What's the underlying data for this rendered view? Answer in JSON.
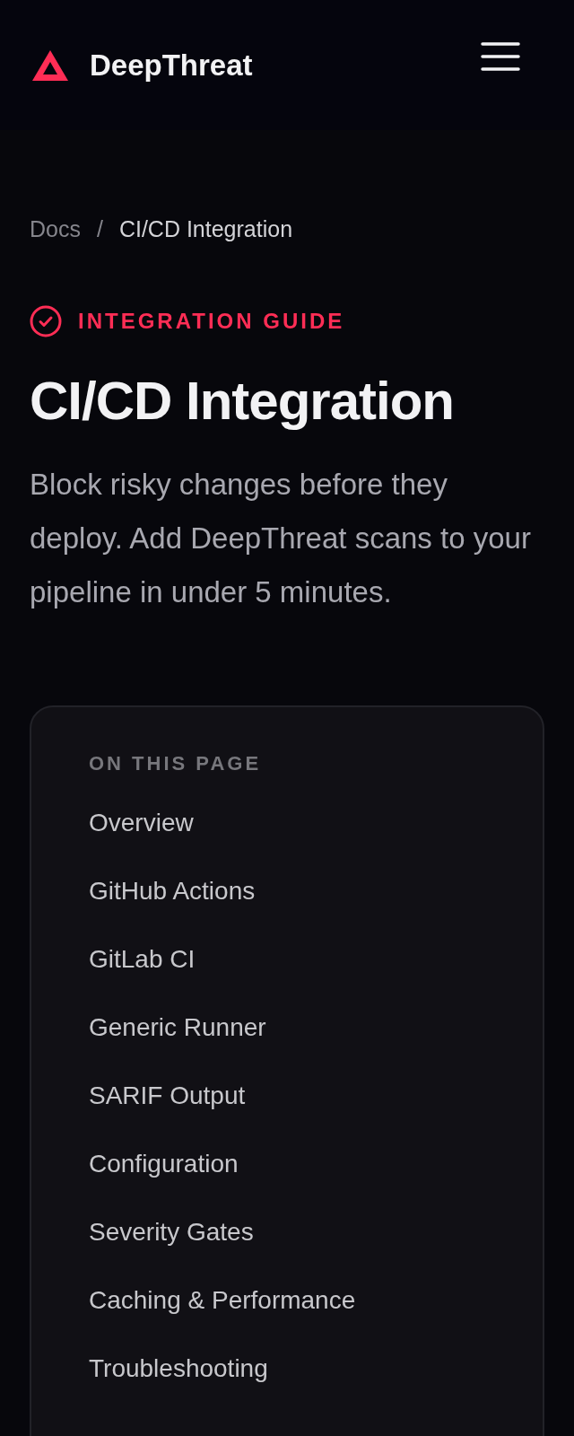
{
  "header": {
    "brand": "DeepThreat"
  },
  "breadcrumb": [
    {
      "label": "Docs",
      "kind": "link"
    },
    {
      "label": "/",
      "kind": "separator"
    },
    {
      "label": "CI/CD Integration",
      "kind": "current"
    }
  ],
  "eyebrow": "INTEGRATION GUIDE",
  "title": "CI/CD Integration",
  "lead": "Block risky changes before they deploy. Add DeepThreat scans to your pipeline in under 5 minutes.",
  "toc": {
    "heading": "ON THIS PAGE",
    "items": [
      "Overview",
      "GitHub Actions",
      "GitLab CI",
      "Generic Runner",
      "SARIF Output",
      "Configuration",
      "Severity Gates",
      "Caching & Performance",
      "Troubleshooting"
    ]
  }
}
